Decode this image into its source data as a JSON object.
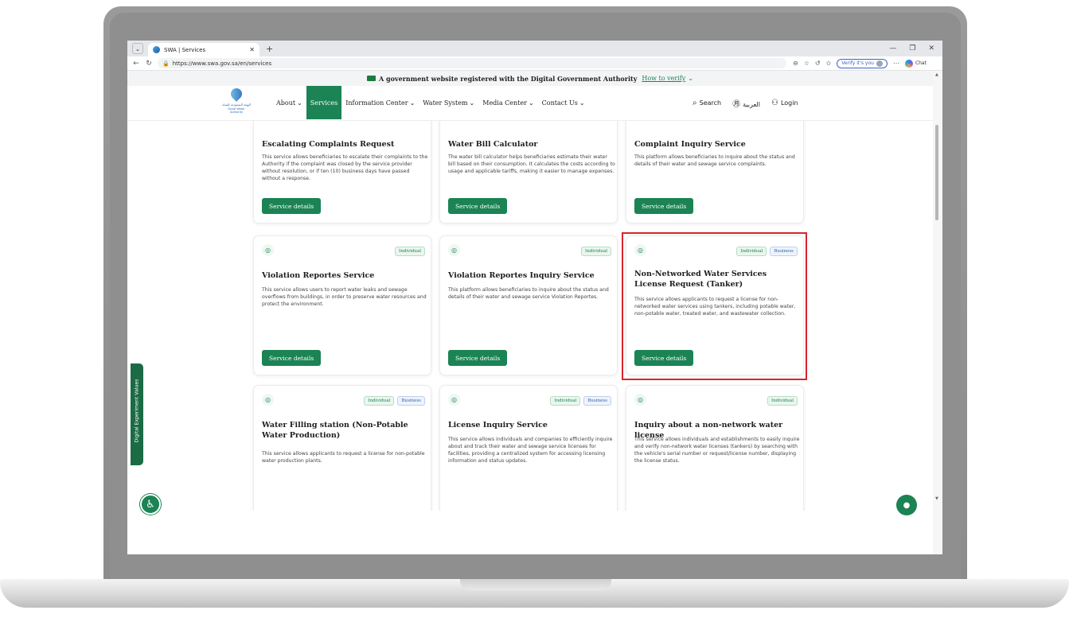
{
  "browser": {
    "tab_title": "SWA | Services",
    "new_tab": "+",
    "url": "https://www.swa.gov.sa/en/services",
    "verify_label": "Verify it's you",
    "copilot_label": "Chat"
  },
  "banner": {
    "text": "A government website registered with the Digital Government Authority",
    "verify_link": "How to verify"
  },
  "header": {
    "logo_ar": "الهيئة السعودية للمياه",
    "logo_en": "Saudi Water Authority",
    "nav": [
      "About",
      "Services",
      "Information Center",
      "Water System",
      "Media Center",
      "Contact Us"
    ],
    "search": "Search",
    "language": "العربية",
    "login": "Login"
  },
  "cards": [
    {
      "title": "Escalating Complaints Request",
      "desc": "This service allows beneficiaries to escalate their complaints to the Authority if the complaint was closed by the service provider without resolution, or if ten (10) business days have passed without a response.",
      "button": "Service details"
    },
    {
      "title": "Water Bill Calculator",
      "desc": "The water bill calculator helps beneficiaries estimate their water bill based on their consumption. It calculates the costs according to usage and applicable tariffs, making it easier to manage expenses.",
      "button": "Service details"
    },
    {
      "title": "Complaint Inquiry Service",
      "desc": "This platform allows beneficiaries to inquire about the status and details of their water and sewage service complaints.",
      "button": "Service details"
    },
    {
      "badges": [
        "Individual"
      ],
      "title": "Violation Reportes Service",
      "desc": "This service allows users to report water leaks and sewage overflows from buildings, in order to preserve water resources and protect the environment.",
      "button": "Service details"
    },
    {
      "badges": [
        "Individual"
      ],
      "title": "Violation Reportes Inquiry Service",
      "desc": "This platform allows beneficiaries to inquire about the status and details of their water and sewage service Violation Reportes.",
      "button": "Service details"
    },
    {
      "badges": [
        "Individual",
        "Business"
      ],
      "title": "Non-Networked Water Services License Request (Tanker)",
      "desc": "This service allows applicants to request a license for non-networked water services using tankers, including potable water, non-potable water, treated water, and wastewater collection.",
      "button": "Service details"
    },
    {
      "badges": [
        "Individual",
        "Business"
      ],
      "title": "Water Filling station (Non-Potable Water Production)",
      "desc": "This service allows applicants to request a license for non-potable water production plants."
    },
    {
      "badges": [
        "Individual",
        "Business"
      ],
      "title": "License Inquiry Service",
      "desc": "This service allows individuals and companies to efficiently inquire about and track their water and sewage service licenses for facilities, providing a centralized system for accessing licensing information and status updates."
    },
    {
      "badges": [
        "Individual"
      ],
      "title": "Inquiry about a non-network water license",
      "desc": "This service allows individuals and establishments to easily inquire and verify non-network water licenses (tankers) by searching with the vehicle's serial number or request/license number, displaying the license status."
    }
  ],
  "side_tab": "Digital Experiment Values",
  "colors": {
    "brand_green": "#1b8354",
    "highlight_red": "#d9232e"
  },
  "icons": [
    "water-drop-icon",
    "search-icon",
    "language-icon",
    "user-icon",
    "accessibility-icon",
    "chat-icon"
  ]
}
